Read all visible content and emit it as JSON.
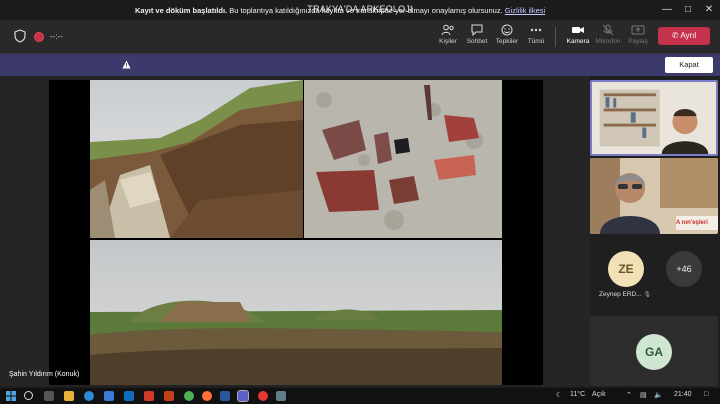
{
  "window": {
    "title": "TRAKYA'DA ARKEOLOJI"
  },
  "toolbar": {
    "timer": "--:--",
    "buttons": [
      {
        "label": "Kişiler",
        "icon": "people-icon"
      },
      {
        "label": "Sohbet",
        "icon": "chat-icon"
      },
      {
        "label": "Tepkiler",
        "icon": "reactions-icon"
      },
      {
        "label": "Tümü",
        "icon": "more-icon"
      },
      {
        "label": "Kamera",
        "icon": "camera-icon"
      },
      {
        "label": "Mikrofon",
        "icon": "microphone-icon"
      },
      {
        "label": "Paylaş",
        "icon": "share-icon"
      }
    ],
    "leave_label": "Ayrıl"
  },
  "banner": {
    "title": "Kayıt ve döküm başlatıldı.",
    "message": "Bu toplantıya katıldığınızda kayıtta ve transkriptte yer almayı onaylamış olursunuz.",
    "link": "Gizlilik ilkesi",
    "close_label": "Kapat"
  },
  "stage": {
    "presenter": "Şahin Yıldırım (Konuk)"
  },
  "participants": [
    {
      "initials": "ZE",
      "name": "Zeynep ERD...",
      "color": "#f2e1b6"
    },
    {
      "overflow": "+46"
    },
    {
      "initials": "GA",
      "color": "#cfe7d2"
    }
  ],
  "tiles": {
    "video2_caption": "A nın'eşleri"
  },
  "taskbar": {
    "weather": "11°C",
    "weather_desc": "Açık",
    "time": "21:40"
  },
  "colors": {
    "leave": "#c4314b",
    "banner": "#3b3a6b",
    "accent": "#6264a7"
  }
}
